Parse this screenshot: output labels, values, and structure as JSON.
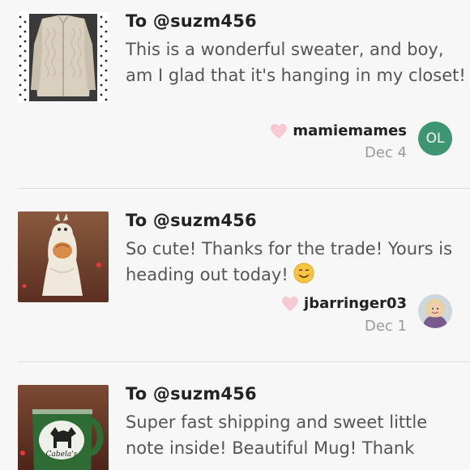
{
  "reviews": [
    {
      "to": "To @suzm456",
      "comment": "This is a wonderful sweater, and boy, am I glad that it's hanging in my closet!",
      "author": "mamiemames",
      "date": "Dec 4",
      "avatar_initials": "OL",
      "thumbnail_icon": "sweater-photo"
    },
    {
      "to": "To @suzm456",
      "comment": "So cute! Thanks for the trade! Yours is heading out today!",
      "emoji": "smiling-face-emoji",
      "author": "jbarringer03",
      "date": "Dec 1",
      "thumbnail_icon": "ghost-figurine-photo"
    },
    {
      "to": "To @suzm456",
      "comment": "Super fast shipping and sweet little note inside! Beautiful Mug! Thank",
      "thumbnail_icon": "moose-mug-photo"
    }
  ],
  "colors": {
    "heart": "#f6c9d3",
    "avatar_green": "#3e9571",
    "secondary_text": "#555555",
    "date_text": "#9a9a9a",
    "divider": "#dcdcdc"
  }
}
